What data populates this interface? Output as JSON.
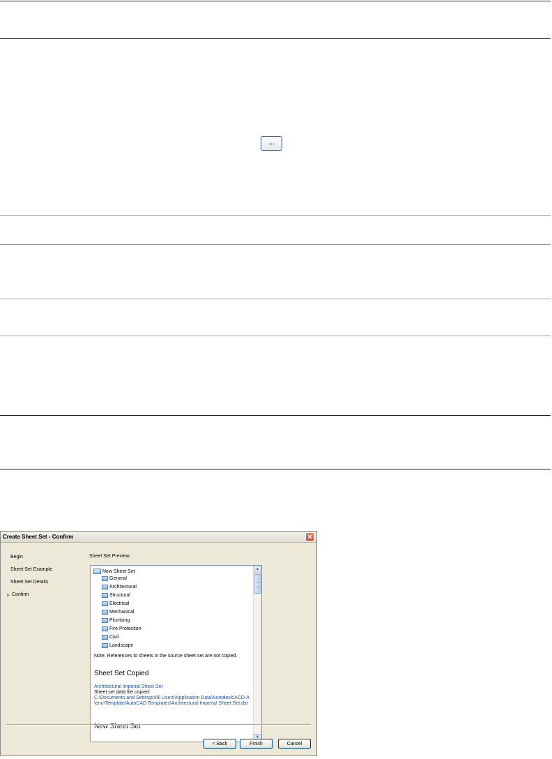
{
  "toolbar": {
    "browse_label": "..."
  },
  "dialog": {
    "title": "Create Sheet Set - Confirm",
    "nav": [
      "Begin",
      "Sheet Set Example",
      "Sheet Set Details",
      "Confirm"
    ],
    "preview_label": "Sheet Set Preview:",
    "tree": {
      "root": "New Sheet Set",
      "children": [
        "General",
        "Architectural",
        "Structural",
        "Electrical",
        "Mechanical",
        "Plumbing",
        "Fire Protection",
        "Civil",
        "Landscape"
      ]
    },
    "note": "Note: References to sheets in the source sheet set are not copied.",
    "copied_heading": "Sheet Set Copied",
    "source_name": "Architectural Imperial Sheet Set",
    "data_file_label": "Sheet set data file copied:",
    "path_line1": "C:\\Documents and Settings\\All Users\\Application Data\\Autodesk\\ACD-A",
    "path_line2": "\\enu\\Template\\AutoCAD Templates\\Architectural Imperial Sheet Set.dst",
    "new_heading": "New Sheet Set",
    "buttons": {
      "back": "< Back",
      "finish": "Finish",
      "cancel": "Cancel"
    }
  }
}
